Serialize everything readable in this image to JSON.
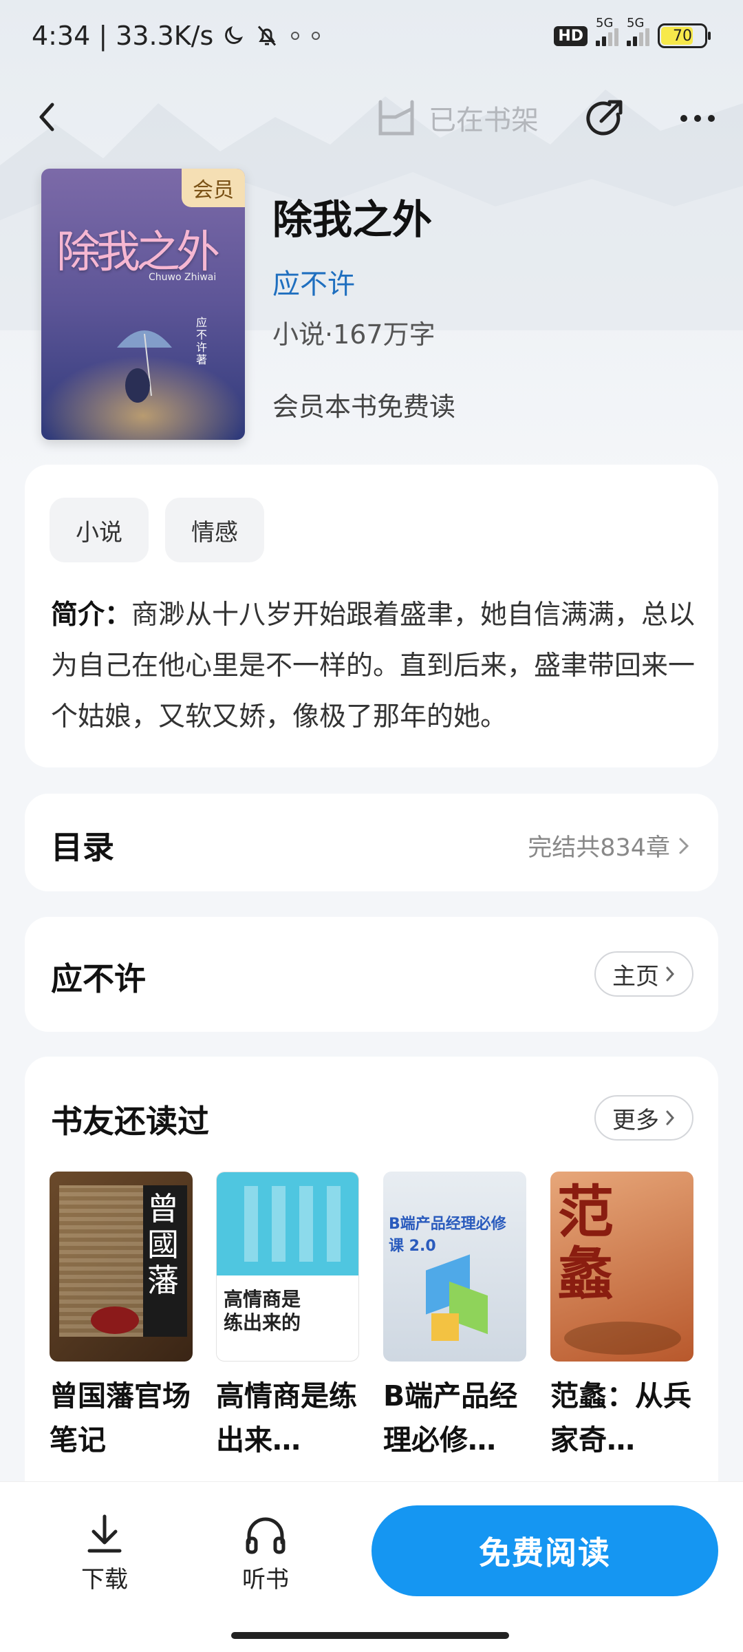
{
  "status_bar": {
    "time": "4:34",
    "speed": "33.3K/s",
    "hd": "HD",
    "net1": "5G",
    "net2": "5G",
    "battery": "70"
  },
  "nav": {
    "shelf_label": "已在书架"
  },
  "book": {
    "vip_tag": "会员",
    "title": "除我之外",
    "author": "应不许",
    "meta": "小说·167万字",
    "vip_note": "会员本书免费读",
    "cover_title": "除我之外",
    "cover_pinyin": "Chuwo Zhiwai",
    "cover_author": "应不许 著"
  },
  "intro": {
    "tags": [
      "小说",
      "情感"
    ],
    "label": "简介：",
    "text": "商渺从十八岁开始跟着盛聿，她自信满满，总以为自己在他心里是不一样的。直到后来，盛聿带回来一个姑娘，又软又娇，像极了那年的她。"
  },
  "toc": {
    "title": "目录",
    "status": "完结共834章"
  },
  "author_card": {
    "name": "应不许",
    "home_label": "主页"
  },
  "recs": {
    "title": "书友还读过",
    "more_label": "更多",
    "books": [
      {
        "title": "曾国藩官场笔记",
        "cover_text": "曾國藩"
      },
      {
        "title": "高情商是练出来…",
        "cover_text": "高情商是练出来的"
      },
      {
        "title": "B端产品经理必修…",
        "cover_text": "B端产品经理必修课 2.0"
      },
      {
        "title": "范蠡：从兵家奇…",
        "cover_text": "范蠡"
      }
    ]
  },
  "bottom": {
    "download_label": "下载",
    "listen_label": "听书",
    "read_label": "免费阅读"
  },
  "colors": {
    "accent": "#1596f2",
    "author_link": "#1f6fbf",
    "vip_bg": "#f5dfb4"
  }
}
